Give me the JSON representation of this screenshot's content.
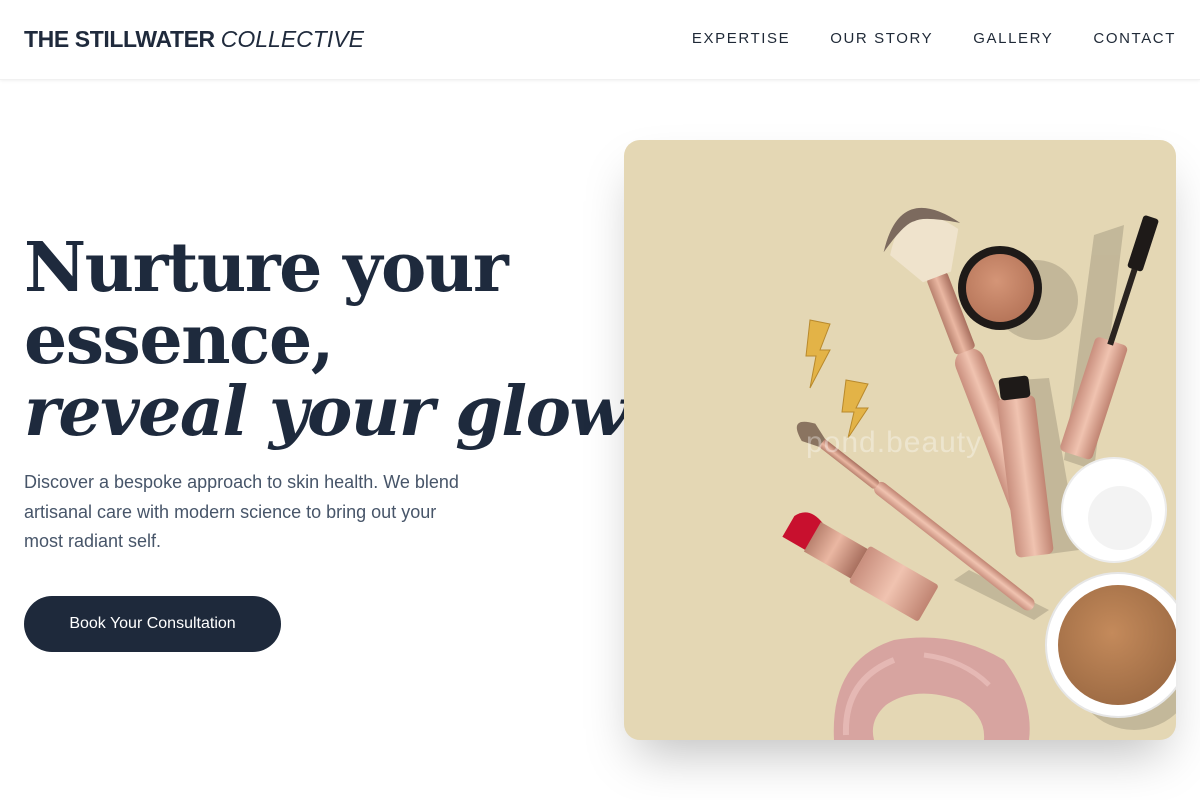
{
  "brand": {
    "name_strong": "THE STILLWATER",
    "name_italic": "COLLECTIVE"
  },
  "nav": {
    "items": [
      {
        "label": "EXPERTISE"
      },
      {
        "label": "OUR STORY"
      },
      {
        "label": "GALLERY"
      },
      {
        "label": "CONTACT"
      }
    ]
  },
  "hero": {
    "headline_line1": "Nurture your",
    "headline_line2": "essence,",
    "headline_line3": "reveal your glow.",
    "description": "Discover a bespoke approach to skin health. We blend artisanal care with modern science to bring out your most radiant self.",
    "cta_label": "Book Your Consultation",
    "image_watermark": "pond.beauty"
  },
  "colors": {
    "primary": "#1e293b",
    "headline": "#1e2a3d",
    "body_text": "#475569",
    "image_background": "#e4d7b4"
  }
}
